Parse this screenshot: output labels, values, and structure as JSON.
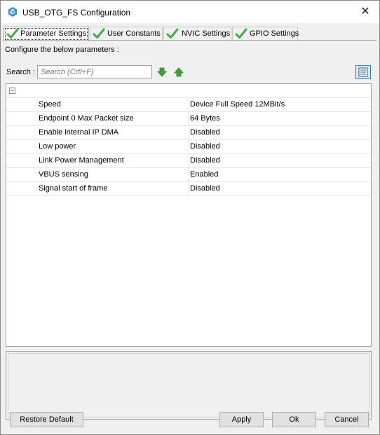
{
  "window": {
    "title": "USB_OTG_FS Configuration",
    "close_glyph": "✕"
  },
  "tabs": [
    {
      "label": "Parameter Settings",
      "active": true,
      "icon": "checkmark-icon"
    },
    {
      "label": "User Constants",
      "active": false,
      "icon": "checkmark-icon"
    },
    {
      "label": "NVIC Settings",
      "active": false,
      "icon": "checkmark-icon"
    },
    {
      "label": "GPIO Settings",
      "active": false,
      "icon": "checkmark-icon"
    }
  ],
  "configure_text": "Configure the below parameters :",
  "search": {
    "label": "Search :",
    "placeholder": "Search (Crtl+F)"
  },
  "group": {
    "toggle_glyph": "−"
  },
  "parameters": [
    {
      "name": "Speed",
      "value": "Device Full Speed 12MBit/s"
    },
    {
      "name": "Endpoint 0 Max Packet size",
      "value": "64 Bytes"
    },
    {
      "name": "Enable internal IP DMA",
      "value": "Disabled"
    },
    {
      "name": "Low power",
      "value": "Disabled"
    },
    {
      "name": "Link Power Management",
      "value": "Disabled"
    },
    {
      "name": "VBUS sensing",
      "value": "Enabled"
    },
    {
      "name": "Signal start of frame",
      "value": "Disabled"
    }
  ],
  "buttons": {
    "restore": "Restore Default",
    "apply": "Apply",
    "ok": "Ok",
    "cancel": "Cancel"
  },
  "colors": {
    "check": "#3fae3f",
    "arrow": "#3aa53a",
    "accent": "#3c7fb1"
  }
}
